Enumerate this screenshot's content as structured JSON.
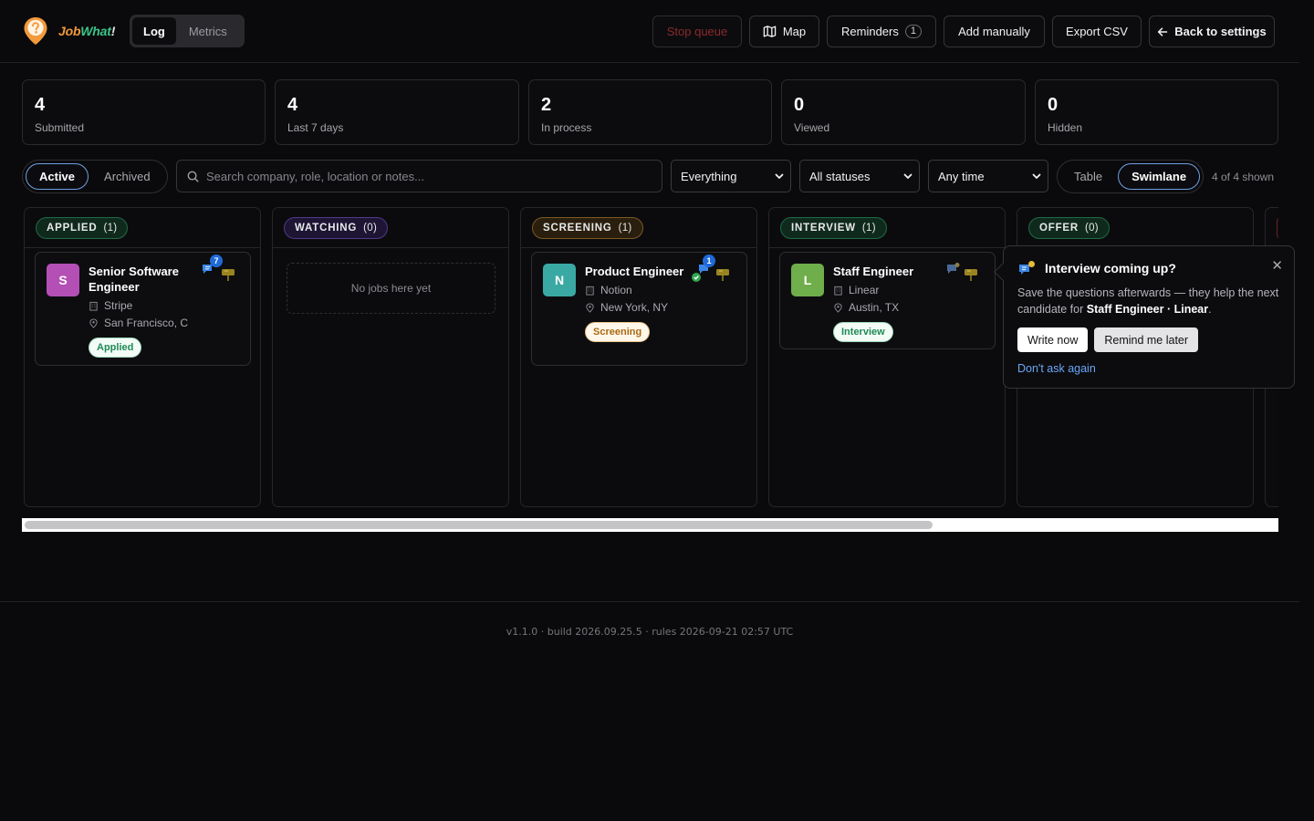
{
  "brand": {
    "part1": "Job",
    "part2": "What",
    "part3": "!"
  },
  "nav": {
    "tabs": [
      {
        "label": "Log",
        "active": true
      },
      {
        "label": "Metrics",
        "active": false
      }
    ]
  },
  "header_actions": {
    "stop_queue": "Stop queue",
    "map": "Map",
    "reminders": "Reminders",
    "reminders_count": "1",
    "add_manually": "Add manually",
    "export_csv": "Export CSV",
    "back": "Back to settings"
  },
  "stats": [
    {
      "value": "4",
      "label": "Submitted"
    },
    {
      "value": "4",
      "label": "Last 7 days"
    },
    {
      "value": "2",
      "label": "In process"
    },
    {
      "value": "0",
      "label": "Viewed"
    },
    {
      "value": "0",
      "label": "Hidden"
    }
  ],
  "filters": {
    "scope": [
      {
        "label": "Active",
        "active": true
      },
      {
        "label": "Archived",
        "active": false
      }
    ],
    "search_placeholder": "Search company, role, location or notes...",
    "type_select": "Everything",
    "status_select": "All statuses",
    "time_select": "Any time",
    "views": [
      {
        "label": "Table",
        "active": false
      },
      {
        "label": "Swimlane",
        "active": true
      }
    ],
    "shown": "4 of 4 shown"
  },
  "lanes": [
    {
      "name": "APPLIED",
      "count": "(1)",
      "color": "#3bc58a",
      "card": {
        "initial": "S",
        "avatar_color": "#b44fb5",
        "title": "Senior Software Engineer",
        "company": "Stripe",
        "location": "San Francisco, C",
        "status": "Applied",
        "status_color": "#1e8a55",
        "notif": "7"
      }
    },
    {
      "name": "WATCHING",
      "count": "(0)",
      "color": "#9b6cf0",
      "empty": "No jobs here yet"
    },
    {
      "name": "SCREENING",
      "count": "(1)",
      "color": "#e3a84a",
      "card": {
        "initial": "N",
        "avatar_color": "#3aa9a3",
        "title": "Product Engineer",
        "company": "Notion",
        "location": "New York, NY",
        "status": "Screening",
        "status_color": "#a86a12",
        "notif": "1"
      }
    },
    {
      "name": "INTERVIEW",
      "count": "(1)",
      "color": "#3bc58a",
      "card": {
        "initial": "L",
        "avatar_color": "#6fae4a",
        "title": "Staff Engineer",
        "company": "Linear",
        "location": "Austin, TX",
        "status": "Interview",
        "status_color": "#1e8a55"
      }
    },
    {
      "name": "OFFER",
      "count": "(0)",
      "color": "#3bc58a"
    }
  ],
  "popover": {
    "title": "Interview coming up?",
    "body_prefix": "Save the questions afterwards — they help the next candidate for ",
    "body_strong": "Staff Engineer · Linear",
    "body_suffix": ".",
    "write_now": "Write now",
    "remind_later": "Remind me later",
    "dont_ask": "Don't ask again"
  },
  "footer": {
    "version": "v1.1.0 · build 2026.09.25.5 · rules 2026-09-21 02:57 UTC"
  }
}
